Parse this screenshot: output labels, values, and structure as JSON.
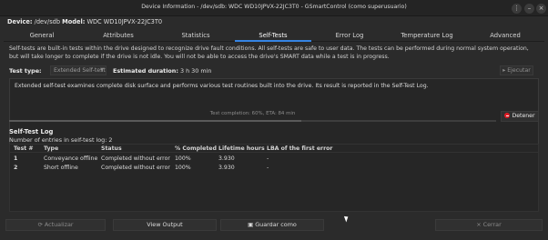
{
  "window": {
    "title": "Device Information - /dev/sdb: WDC WD10JPVX-22JC3T0 - GSmartControl (como superusuario)",
    "menu_icon": "ellipsis-icon",
    "minimize_icon": "minimize-icon",
    "close_icon": "close-icon"
  },
  "device": {
    "label": "Device:",
    "value": "/dev/sdb",
    "model_label": "Model:",
    "model_value": "WDC WD10JPVX-22JC3T0"
  },
  "tabs": [
    {
      "label": "General"
    },
    {
      "label": "Attributes"
    },
    {
      "label": "Statistics"
    },
    {
      "label": "Self-Tests",
      "active": true
    },
    {
      "label": "Error Log"
    },
    {
      "label": "Temperature Log"
    },
    {
      "label": "Advanced"
    }
  ],
  "selftests": {
    "intro_line1": "Self-tests are built-in tests within the drive designed to recognize drive fault conditions. All self-tests are safe to user data. The tests can be performed during normal system operation,",
    "intro_line2": "but will take longer to complete if the drive is not idle. You will not be able to access the drive's SMART data while a test is in progress.",
    "test_type_label": "Test type:",
    "test_type_value": "Extended Self-test",
    "estimated_label": "Estimated duration:",
    "estimated_value": "3 h 30 min",
    "execute_label": "Ejecutar",
    "description": "Extended self-test examines complete disk surface and performs various test routines built into the drive. Its result is reported in the Self-Test Log.",
    "progress_text": "Test completion: 60%, ETA: 84 min",
    "progress_fraction": 0.6,
    "stop_label": "Detener"
  },
  "log": {
    "title": "Self-Test Log",
    "count_text": "Number of entries in self-test log: 2",
    "columns": [
      "Test #",
      "Type",
      "Status",
      "% Completed",
      "Lifetime hours",
      "LBA of the first error"
    ],
    "rows": [
      [
        "1",
        "Conveyance offline",
        "Completed without error",
        "100%",
        "3.930",
        "-"
      ],
      [
        "2",
        "Short offline",
        "Completed without error",
        "100%",
        "3.930",
        "-"
      ]
    ]
  },
  "footer": {
    "refresh_label": "Actualizar",
    "view_output_label": "View Output",
    "save_label": "Guardar como",
    "close_label": "Cerrar"
  },
  "colors": {
    "accent": "#3584e4",
    "stop": "#e01b24",
    "background": "#2b2b2b"
  }
}
